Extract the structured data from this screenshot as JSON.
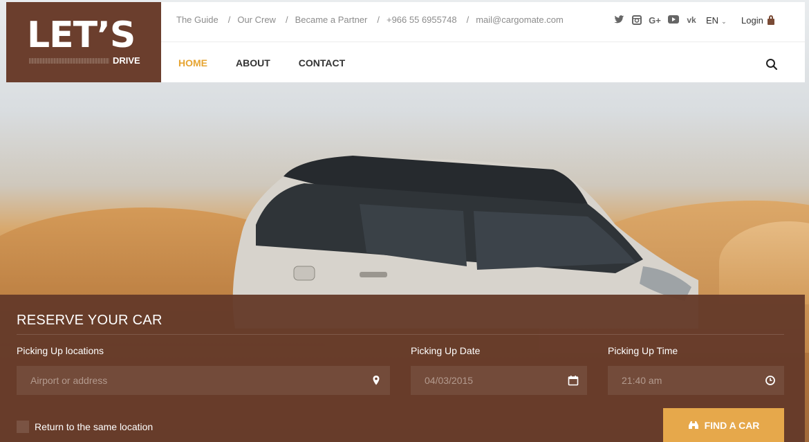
{
  "brand": {
    "logo_main": "LET’S",
    "logo_sub": "DRIVE"
  },
  "topbar": {
    "links": [
      "The Guide",
      "Our Crew",
      "Became a Partner",
      "+966 55 6955748",
      "mail@cargomate.com"
    ],
    "socials": [
      "twitter-icon",
      "instagram-icon",
      "google-plus-icon",
      "youtube-icon",
      "vk-icon"
    ],
    "language": "EN",
    "login": "Login"
  },
  "nav": {
    "items": [
      "HOME",
      "ABOUT",
      "CONTACT"
    ],
    "active": "HOME"
  },
  "reserve": {
    "title": "RESERVE YOUR CAR",
    "location_label": "Picking Up locations",
    "location_placeholder": "Airport or address",
    "date_label": "Picking Up Date",
    "date_value": "04/03/2015",
    "time_label": "Picking Up Time",
    "time_value": "21:40 am",
    "return_label": "Return to the same location",
    "find_button": "FIND A CAR"
  },
  "colors": {
    "brand_brown": "#6b3e2d",
    "accent_orange": "#e6a431",
    "button_orange": "#e6a84b"
  }
}
